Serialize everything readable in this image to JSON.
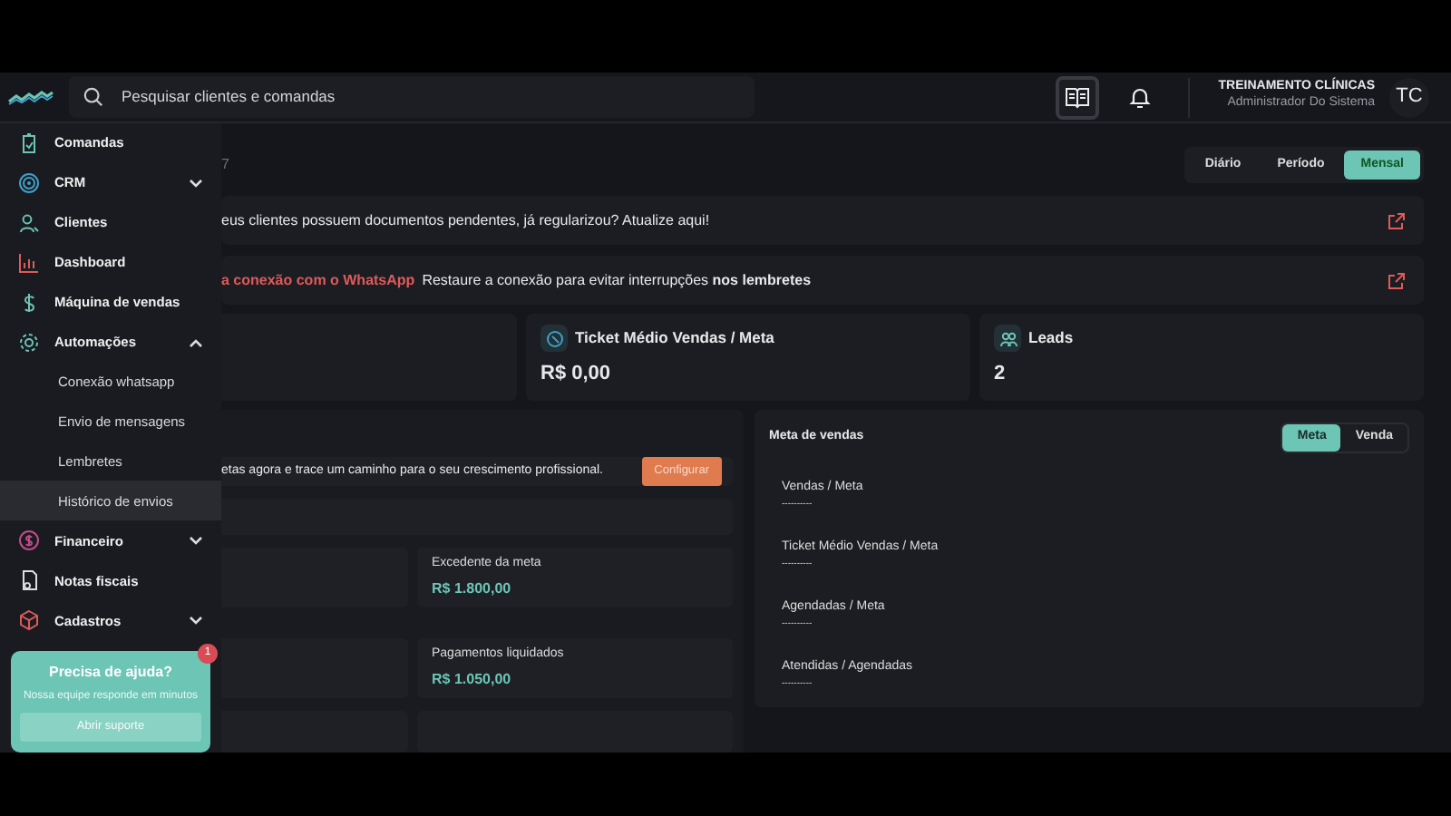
{
  "header": {
    "search": {
      "placeholder": "Pesquisar clientes e comandas"
    },
    "user": {
      "name": "TREINAMENTO CLÍNICAS",
      "role": "Administrador Do Sistema",
      "initials": "TC"
    }
  },
  "sidebar": {
    "items": [
      {
        "label": "Comandas",
        "kind": "link"
      },
      {
        "label": "CRM",
        "kind": "group",
        "expanded": false
      },
      {
        "label": "Clientes",
        "kind": "link"
      },
      {
        "label": "Dashboard",
        "kind": "link"
      },
      {
        "label": "Máquina de vendas",
        "kind": "link"
      },
      {
        "label": "Automações",
        "kind": "group",
        "expanded": true,
        "children": [
          {
            "label": "Conexão whatsapp",
            "selected": false
          },
          {
            "label": "Envio de mensagens",
            "selected": false
          },
          {
            "label": "Lembretes",
            "selected": false
          },
          {
            "label": "Histórico de envios",
            "selected": true
          }
        ]
      },
      {
        "label": "Financeiro",
        "kind": "group",
        "expanded": false
      },
      {
        "label": "Notas fiscais",
        "kind": "link"
      },
      {
        "label": "Cadastros",
        "kind": "group",
        "expanded": false
      }
    ],
    "help": {
      "title": "Precisa de ajuda?",
      "text": "Nossa equipe responde em minutos",
      "button": "Abrir suporte",
      "badge": "1"
    }
  },
  "date_fragment": "7",
  "period_tabs": [
    {
      "label": "Diário",
      "selected": false
    },
    {
      "label": "Período",
      "selected": false
    },
    {
      "label": "Mensal",
      "selected": true
    }
  ],
  "alerts": [
    {
      "kind": "info",
      "text": "eus clientes possuem documentos pendentes, já regularizou? Atualize aqui!"
    },
    {
      "kind": "warning",
      "title": "a conexão com o WhatsApp",
      "text": "Restaure a conexão para evitar interrupções **nos lembretes**"
    }
  ],
  "stats": [
    {
      "title": "Ticket Médio Vendas / Meta",
      "value": "R$ 0,00"
    },
    {
      "title": "Leads",
      "value": "2"
    }
  ],
  "goals_panel": {
    "banner": {
      "text": "etas agora e trace um caminho para o seu crescimento profissional.",
      "button": "Configurar"
    },
    "metrics": [
      {
        "label": "Excedente da meta",
        "value": "R$ 1.800,00"
      },
      {
        "label": "Pagamentos liquidados",
        "value": "R$ 1.050,00"
      }
    ]
  },
  "sales_goal": {
    "title": "Meta de vendas",
    "toggle": [
      {
        "label": "Meta",
        "selected": true
      },
      {
        "label": "Venda",
        "selected": false
      }
    ],
    "rows": [
      {
        "label": "Vendas / Meta",
        "value": "----------"
      },
      {
        "label": "Ticket Médio Vendas / Meta",
        "value": "----------"
      },
      {
        "label": "Agendadas / Meta",
        "value": "----------"
      },
      {
        "label": "Atendidas / Agendadas",
        "value": "----------"
      }
    ]
  }
}
